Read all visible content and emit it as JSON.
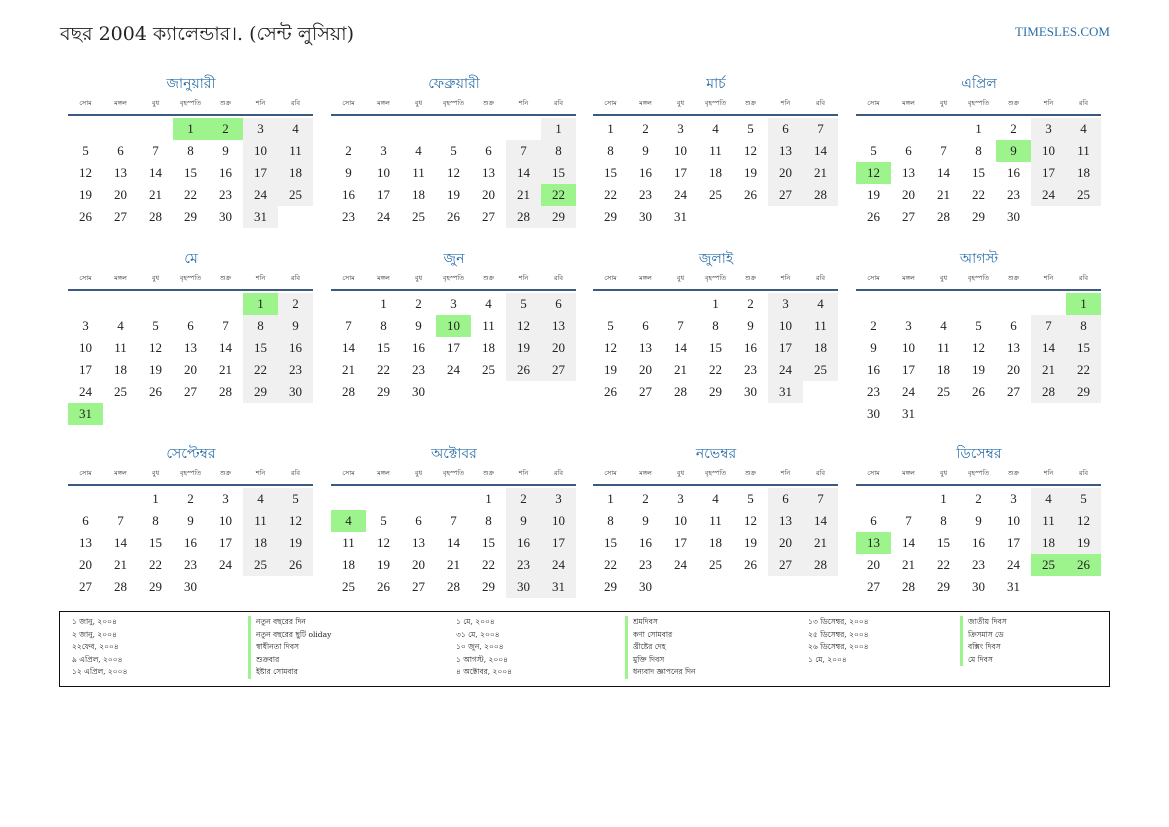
{
  "title": "বছর 2004 ক্যালেন্ডার।. (সেন্ট লুসিয়া)",
  "brand": "TIMESLES.COM",
  "weekdays": [
    "সোম",
    "মঙ্গল",
    "বুধ",
    "বৃহস্পতি",
    "শুক্র",
    "শনি",
    "রবি"
  ],
  "months": [
    {
      "name": "জানুয়ারী",
      "offset": 3,
      "days": 31,
      "holidays": [
        1,
        2
      ]
    },
    {
      "name": "ফেব্রুয়ারী",
      "offset": 6,
      "days": 29,
      "holidays": [
        22
      ]
    },
    {
      "name": "মার্চ",
      "offset": 0,
      "days": 31,
      "holidays": []
    },
    {
      "name": "এপ্রিল",
      "offset": 3,
      "days": 30,
      "holidays": [
        9,
        12
      ]
    },
    {
      "name": "মে",
      "offset": 5,
      "days": 31,
      "holidays": [
        1,
        31
      ]
    },
    {
      "name": "জুন",
      "offset": 1,
      "days": 30,
      "holidays": [
        10
      ]
    },
    {
      "name": "জুলাই",
      "offset": 3,
      "days": 31,
      "holidays": []
    },
    {
      "name": "আগস্ট",
      "offset": 6,
      "days": 31,
      "holidays": [
        1
      ]
    },
    {
      "name": "সেপ্টেম্বর",
      "offset": 2,
      "days": 30,
      "holidays": []
    },
    {
      "name": "অক্টোবর",
      "offset": 4,
      "days": 31,
      "holidays": [
        4
      ]
    },
    {
      "name": "নভেম্বর",
      "offset": 0,
      "days": 30,
      "holidays": []
    },
    {
      "name": "ডিসেম্বর",
      "offset": 2,
      "days": 31,
      "holidays": [
        13,
        25,
        26
      ]
    }
  ],
  "holidays_list": [
    [
      {
        "date": "১ জানু, ২০০৪",
        "name": "নতুন বছরের দিন"
      },
      {
        "date": "২ জানু, ২০০৪",
        "name": "নতুন বছরের ছুটি oliday"
      },
      {
        "date": "২২ফেব, ২০০৪",
        "name": "স্বাধীনতা দিবস"
      },
      {
        "date": "৯ এপ্রিল, ২০০৪",
        "name": "শুক্রবার"
      },
      {
        "date": "১২ এপ্রিল, ২০০৪",
        "name": "ইষ্টার সোমবার"
      }
    ],
    [
      {
        "date": "১ মে, ২০০৪",
        "name": "শ্রমদিবস"
      },
      {
        "date": "৩১ মে, ২০০৪",
        "name": "কণা সোমবার"
      },
      {
        "date": "১০ জুন, ২০০৪",
        "name": "খ্রীষ্টের দেহ"
      },
      {
        "date": "১ আগস্ট, ২০০৪",
        "name": "মুক্তি দিবস"
      },
      {
        "date": "৪ অক্টোবর, ২০০৪",
        "name": "ধন্যবাদ জ্ঞাপনের দিন"
      }
    ],
    [
      {
        "date": "১৩ ডিসেম্বর, ২০০৪",
        "name": "জাতীয় দিবস"
      },
      {
        "date": "২৫ ডিসেম্বর, ২০০৪",
        "name": "ক্রিসমাস ডে"
      },
      {
        "date": "২৬ ডিসেম্বর, ২০০৪",
        "name": "বক্সিং দিবস"
      },
      {
        "date": "১ মে, ২০০৪",
        "name": "মে দিবস"
      }
    ]
  ]
}
